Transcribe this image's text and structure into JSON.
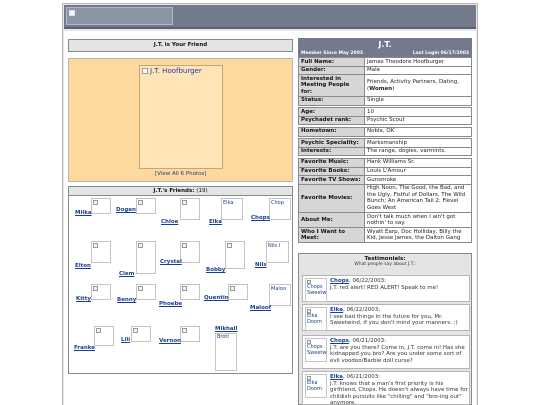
{
  "profile": {
    "name": "J.T.",
    "member_since": "Member Since May 2003",
    "last_login": "Last Login 06/17/2003",
    "is_friend_header": "J.T. is Your Friend",
    "main_photo_caption": "J.T. Hoofburger",
    "view_photos": "[View All 6 Photos]"
  },
  "info": [
    {
      "label": "Full Name:",
      "value": "James Theodore Hoofburger"
    },
    {
      "label": "Gender:",
      "value": "Male"
    },
    {
      "label": "Interested in Meeting People for:",
      "value": "Friends, Activity Partners, Dating, (",
      "value_bold": "Women",
      "value_end": ")"
    },
    {
      "label": "Status:",
      "value": "Single"
    },
    {
      "label": "Age:",
      "value": "10"
    },
    {
      "label": "Psychadet rank:",
      "value": "Psychic Scout"
    },
    {
      "label": "Hometown:",
      "value": "Noble, OK"
    },
    {
      "label": "Psychic Speciality:",
      "value": "Marksmanship"
    },
    {
      "label": "Interests:",
      "value": "The range, dogies, varmints."
    },
    {
      "label": "Favorite Music:",
      "value": "Hank Williams Sr."
    },
    {
      "label": "Favorite Books:",
      "value": "Louis L'Amour"
    },
    {
      "label": "Favorite TV Shows:",
      "value": "Gunsmoke"
    },
    {
      "label": "Favorite Movies:",
      "value": "High Noon, The Good, the Bad, and the Ugly, Fistful of Dollars, The Wild Bunch; An American Tail 2: Fievel Goes West"
    },
    {
      "label": "About Me:",
      "value": "Don't talk much when I ain't got nothin' to say."
    },
    {
      "label": "Who I Want to Meet:",
      "value": "Wyatt Earp, Doc Holliday, Billy the Kid, Jesse James, the Dalton Gang"
    }
  ],
  "friends": {
    "header_label": "J.T.'s Friends:",
    "count": "(19)",
    "names": [
      "Milka",
      "Dogen",
      "Chloe",
      "Elka",
      "Chops",
      "Elton",
      "Clem",
      "Crystal",
      "Bobby",
      "Nils",
      "Kitty",
      "Benny",
      "Phoebe",
      "Quentin",
      "Maloof",
      "Franke",
      "Lili",
      "Vernon",
      "Mikhail"
    ],
    "image_alts": [
      "Elka",
      "Chop",
      "Nils I",
      "Maloo",
      "Mikhail",
      "Brotl"
    ]
  },
  "testimonials": {
    "title": "Testimonials:",
    "subtitle": "What people say about J.T.:",
    "items": [
      {
        "author": "Chops",
        "date": ", 06/22/2003:",
        "text": "J.T. red alert! RED ALERT! Speak to me!",
        "img_alt": "Chops Sweetw"
      },
      {
        "author": "Elka",
        "date": ", 06/22/2003:",
        "text": "I see bad things in the future for you, Mr. Sweetwind, if you don't mind your manners. ;)",
        "img_alt": "Elka Doom"
      },
      {
        "author": "Chops",
        "date": ", 06/21/2003:",
        "text": "J.T. are you there? Come in, J.T. come in! Has she kidnapped you bro? Are you under some sort of evil voodoo/Barbie doll curse?",
        "img_alt": "Chops Sweetw"
      },
      {
        "author": "Elka",
        "date": ", 06/21/2003:",
        "text": "J.T. knows that a man's first priority is his girlfriend, Chops. He doesn't always have time for childish pursuits like \"chilling\" and \"bro-ing out\" anymore.",
        "img_alt": "Elka Doom"
      }
    ]
  }
}
